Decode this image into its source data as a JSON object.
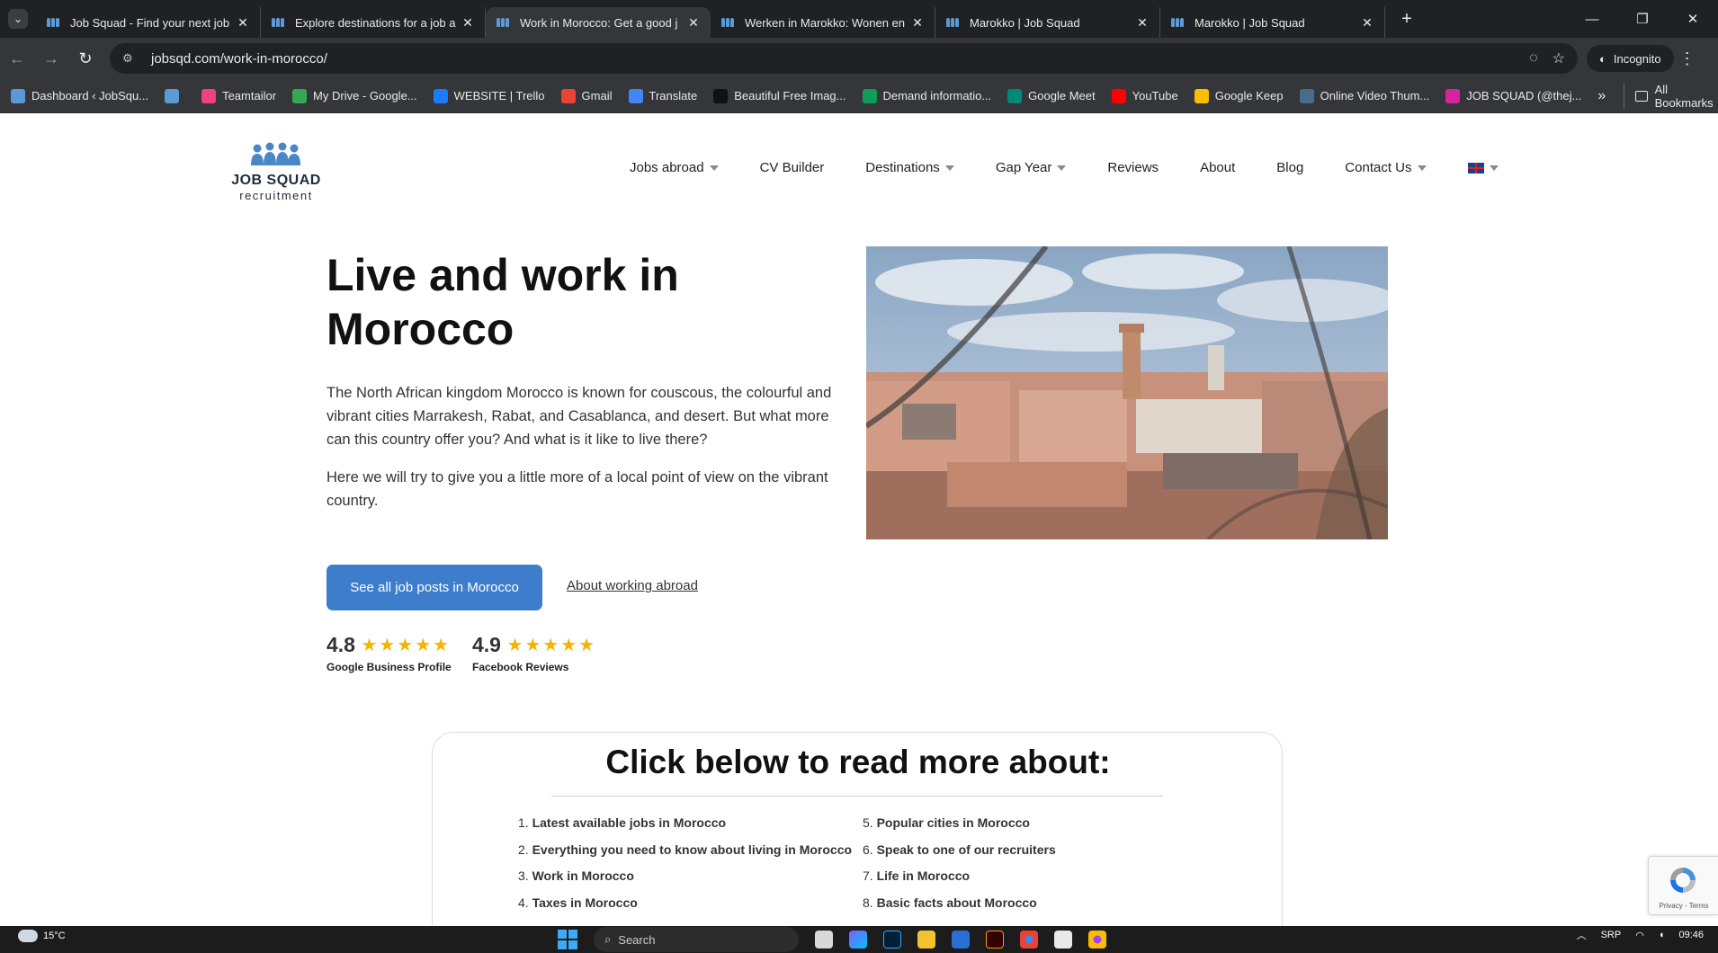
{
  "browser": {
    "tabs": [
      {
        "title": "Job Squad - Find your next job",
        "active": false
      },
      {
        "title": "Explore destinations for a job a",
        "active": false
      },
      {
        "title": "Work in Morocco: Get a good j",
        "active": true
      },
      {
        "title": "Werken in Marokko: Wonen en",
        "active": false
      },
      {
        "title": "Marokko | Job Squad",
        "active": false
      },
      {
        "title": "Marokko | Job Squad",
        "active": false
      }
    ],
    "url": "jobsqd.com/work-in-morocco/",
    "incognito_label": "Incognito",
    "bookmarks": [
      {
        "label": "Dashboard ‹ JobSqu...",
        "icon": "job-squad-icon",
        "color": "#5b9bd5"
      },
      {
        "label": "",
        "icon": "job-squad-icon",
        "color": "#5b9bd5"
      },
      {
        "label": "Teamtailor",
        "icon": "teamtailor-icon",
        "color": "#f0437a"
      },
      {
        "label": "My Drive - Google...",
        "icon": "google-drive-icon",
        "color": "#34a853"
      },
      {
        "label": "WEBSITE | Trello",
        "icon": "trello-icon",
        "color": "#1d7afc"
      },
      {
        "label": "Gmail",
        "icon": "gmail-icon",
        "color": "#ea4335"
      },
      {
        "label": "Translate",
        "icon": "translate-icon",
        "color": "#4285f4"
      },
      {
        "label": "Beautiful Free Imag...",
        "icon": "unsplash-icon",
        "color": "#111111"
      },
      {
        "label": "Demand informatio...",
        "icon": "sheets-icon",
        "color": "#0f9d58"
      },
      {
        "label": "Google Meet",
        "icon": "meet-icon",
        "color": "#00897b"
      },
      {
        "label": "YouTube",
        "icon": "youtube-icon",
        "color": "#ff0000"
      },
      {
        "label": "Google Keep",
        "icon": "keep-icon",
        "color": "#fbbc04"
      },
      {
        "label": "Online Video Thum...",
        "icon": "thumbnail-icon",
        "color": "#4a6b8a"
      },
      {
        "label": "JOB SQUAD (@thej...",
        "icon": "instagram-icon",
        "color": "#d6249f"
      }
    ],
    "all_bookmarks_label": "All Bookmarks"
  },
  "site": {
    "logo": {
      "line1": "JOB SQUAD",
      "line2": "recruitment"
    },
    "nav": [
      {
        "label": "Jobs abroad",
        "dropdown": true
      },
      {
        "label": "CV Builder",
        "dropdown": false
      },
      {
        "label": "Destinations",
        "dropdown": true
      },
      {
        "label": "Gap Year",
        "dropdown": true
      },
      {
        "label": "Reviews",
        "dropdown": false
      },
      {
        "label": "About",
        "dropdown": false
      },
      {
        "label": "Blog",
        "dropdown": false
      },
      {
        "label": "Contact Us",
        "dropdown": true
      }
    ],
    "language_icon": "uk-flag-icon"
  },
  "hero": {
    "title_line1": "Live and work in",
    "title_line2": "Morocco",
    "paragraph1": "The North African kingdom Morocco is known for couscous, the colourful and vibrant cities Marrakesh, Rabat, and Casablanca, and desert. But what more can this country offer you? And what is it like to live there?",
    "paragraph2": "Here we will try to give you a little more of a local point of view on the vibrant country.",
    "cta_label": "See all job posts in Morocco",
    "secondary_link": "About working abroad",
    "ratings": [
      {
        "score": "4.8",
        "stars": 5,
        "label": "Google Business Profile"
      },
      {
        "score": "4.9",
        "stars": 5,
        "label": "Facebook Reviews"
      }
    ]
  },
  "read_more": {
    "title": "Click below to read more about:",
    "items": [
      "Latest available jobs in Morocco",
      "Everything you need to know about living in Morocco",
      "Work in Morocco",
      "Taxes in Morocco",
      "Popular cities in Morocco",
      "Speak to one of our recruiters",
      "Life in Morocco",
      "Basic facts about Morocco"
    ]
  },
  "recaptcha": {
    "footer": "Privacy - Terms"
  },
  "taskbar": {
    "temperature": "15°C",
    "search_placeholder": "Search",
    "language": "SRP",
    "time": "09:46"
  },
  "colors": {
    "brand_blue": "#3d7dcb",
    "star": "#f5b400",
    "logo_people": "#4a86c8"
  }
}
